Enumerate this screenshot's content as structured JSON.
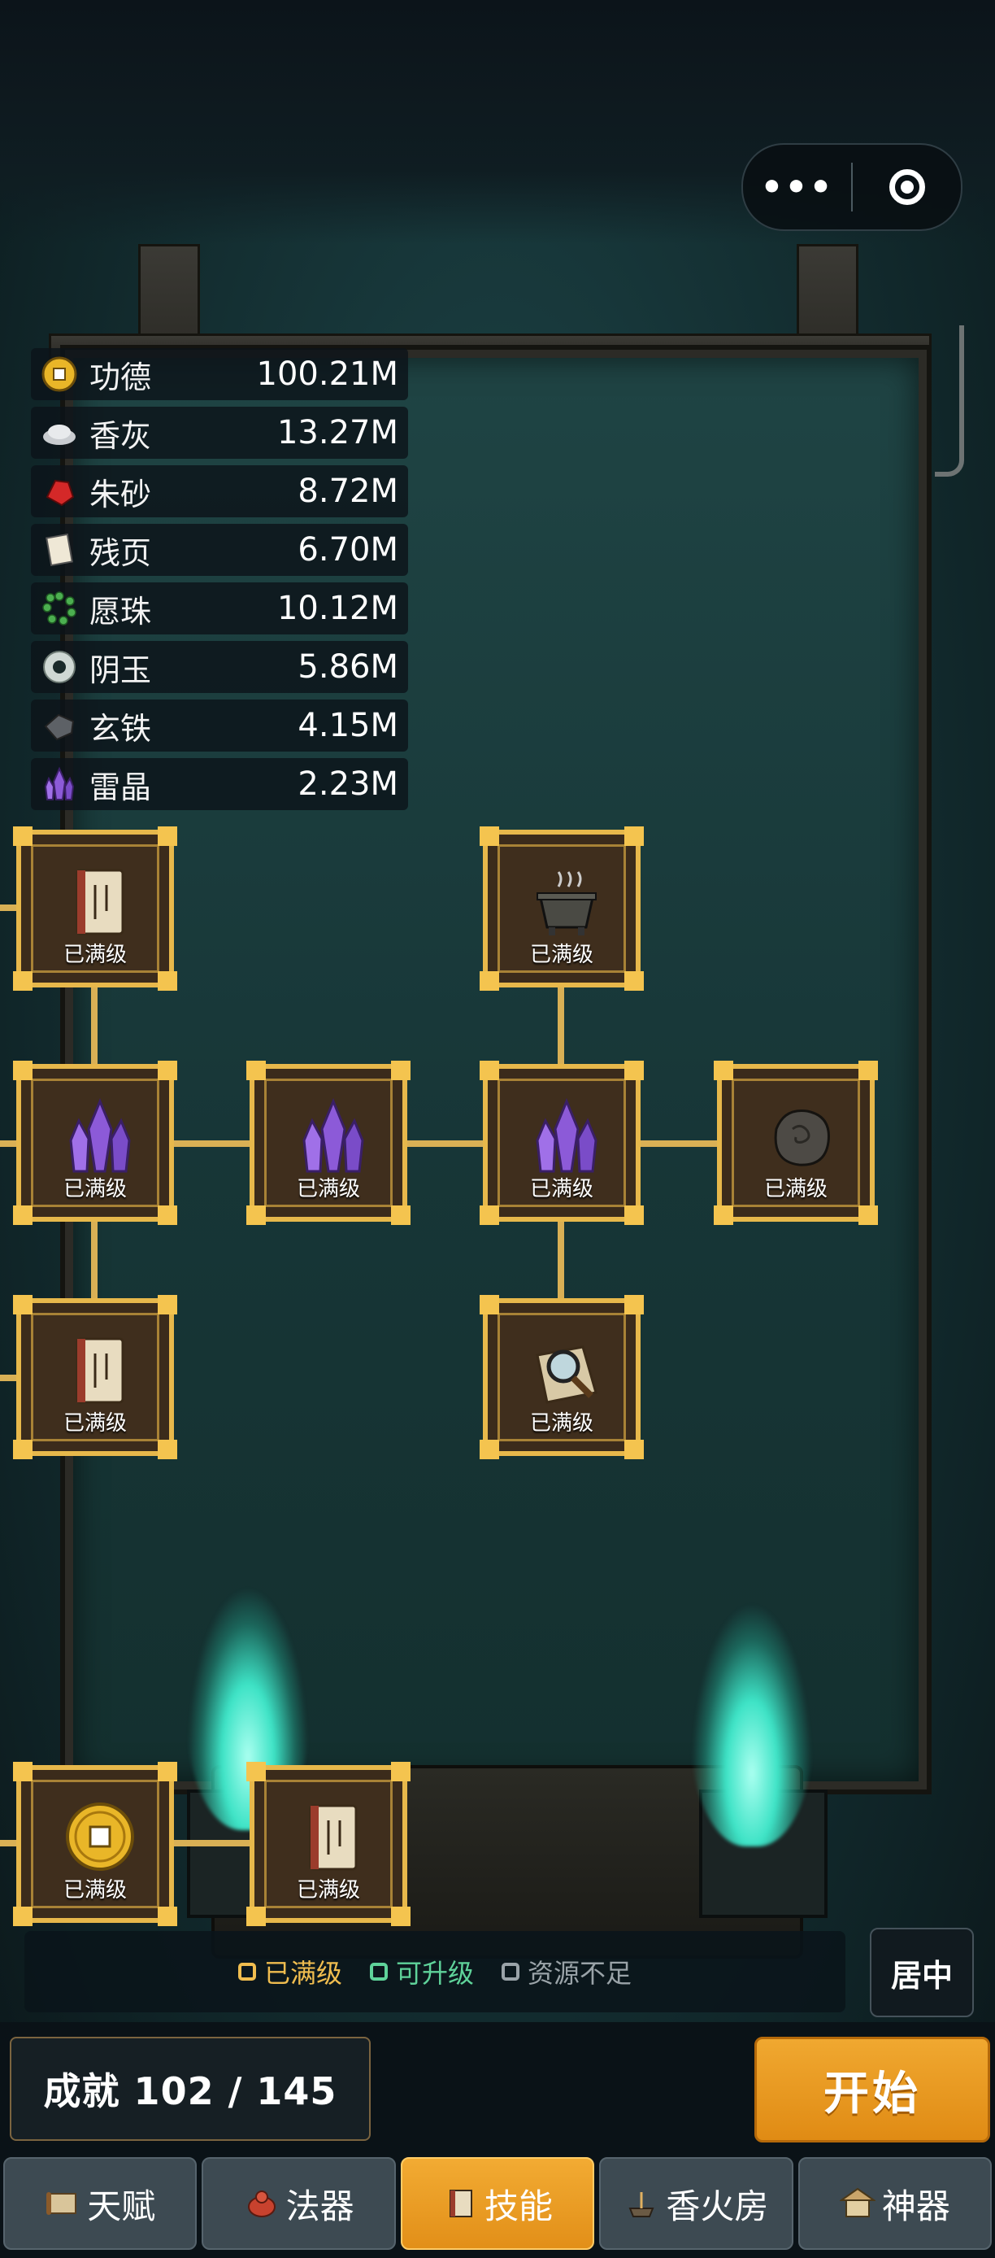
{
  "capsule": {
    "more": "•••"
  },
  "resources": [
    {
      "name": "功德",
      "value": "100.21M",
      "icon": "coin-icon"
    },
    {
      "name": "香灰",
      "value": "13.27M",
      "icon": "ash-icon"
    },
    {
      "name": "朱砂",
      "value": "8.72M",
      "icon": "cinnabar-icon"
    },
    {
      "name": "残页",
      "value": "6.70M",
      "icon": "page-icon"
    },
    {
      "name": "愿珠",
      "value": "10.12M",
      "icon": "beads-icon"
    },
    {
      "name": "阴玉",
      "value": "5.86M",
      "icon": "jade-ring-icon"
    },
    {
      "name": "玄铁",
      "value": "4.15M",
      "icon": "iron-icon"
    },
    {
      "name": "雷晶",
      "value": "2.23M",
      "icon": "crystal-icon"
    }
  ],
  "nodes": [
    {
      "label": "已满级",
      "icon": "book-icon"
    },
    {
      "label": "已满级",
      "icon": "incense-burner-icon"
    },
    {
      "label": "已满级",
      "icon": "crystal-icon"
    },
    {
      "label": "已满级",
      "icon": "crystal-icon"
    },
    {
      "label": "已满级",
      "icon": "crystal-icon"
    },
    {
      "label": "已满级",
      "icon": "ore-icon"
    },
    {
      "label": "已满级",
      "icon": "book-icon"
    },
    {
      "label": "已满级",
      "icon": "magnifier-icon"
    },
    {
      "label": "已满级",
      "icon": "coin-icon"
    },
    {
      "label": "已满级",
      "icon": "book-icon"
    }
  ],
  "legend": {
    "maxed": "已满级",
    "upgradable": "可升级",
    "insufficient": "资源不足",
    "colors": {
      "maxed": "#f0bd4f",
      "upgradable": "#5fd39a",
      "insufficient": "#9aa3a8"
    }
  },
  "center_button": "居中",
  "achievement": "成就 102 / 145",
  "start_button": "开始",
  "tabs": [
    {
      "label": "天赋",
      "icon": "scroll-icon",
      "active": false
    },
    {
      "label": "法器",
      "icon": "gourd-icon",
      "active": false
    },
    {
      "label": "技能",
      "icon": "skill-book-icon",
      "active": true
    },
    {
      "label": "香火房",
      "icon": "incense-icon",
      "active": false
    },
    {
      "label": "神器",
      "icon": "shrine-icon",
      "active": false
    }
  ],
  "colors": {
    "accent": "#e7b84b",
    "active_tab": "#f0a830"
  }
}
